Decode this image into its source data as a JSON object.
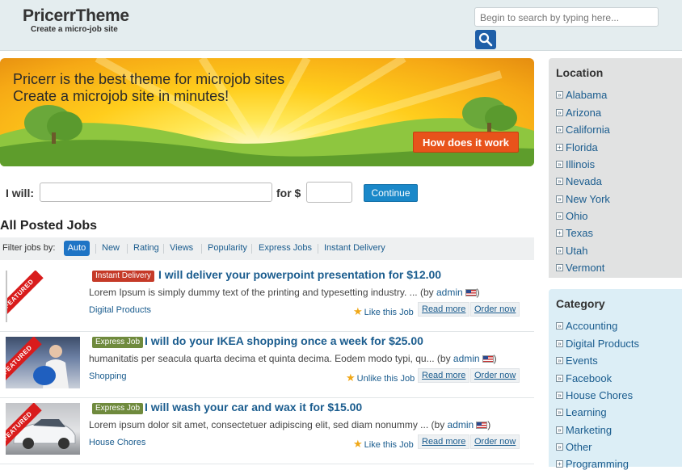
{
  "header": {
    "logo": "PricerrTheme",
    "tagline": "Create a micro-job site",
    "search_placeholder": "Begin to search by typing here..."
  },
  "banner": {
    "line1": "Pricerr is the best theme for microjob sites",
    "line2": "Create a microjob site in minutes!",
    "button": "How does it work"
  },
  "post_form": {
    "i_will_label": "I will:",
    "for_label": "for $",
    "continue_label": "Continue"
  },
  "jobs_section": {
    "title": "All Posted Jobs",
    "filter_label": "Filter jobs by:",
    "filters": [
      "Auto",
      "New",
      "Rating",
      "Views",
      "Popularity",
      "Express Jobs",
      "Instant Delivery"
    ]
  },
  "jobs": [
    {
      "featured": "FEATURED",
      "badge": "Instant Delivery",
      "title": "I will deliver your powerpoint presentation for $12.00",
      "desc": "Lorem Ipsum is simply dummy text of the printing and typesetting industry. ... (by ",
      "author": "admin",
      "desc_end": ")",
      "category": "Digital Products",
      "like": "Like this Job",
      "read_more": "Read more",
      "order_now": "Order now"
    },
    {
      "featured": "FEATURED",
      "badge": "Express Job",
      "title": "I will do your IKEA shopping once a week for $25.00",
      "desc": "humanitatis per seacula quarta decima et quinta decima. Eodem modo typi, qu... (by ",
      "author": "admin",
      "desc_end": ")",
      "category": "Shopping",
      "like": "Unlike this Job",
      "read_more": "Read more",
      "order_now": "Order now"
    },
    {
      "featured": "FEATURED",
      "badge": "Express Job",
      "title": "I will wash your car and wax it for $15.00",
      "desc": "Lorem ipsum dolor sit amet, consectetuer adipiscing elit, sed diam nonummy ... (by ",
      "author": "admin",
      "desc_end": ")",
      "category": "House Chores",
      "like": "Like this Job",
      "read_more": "Read more",
      "order_now": "Order now"
    }
  ],
  "sidebar": {
    "location_title": "Location",
    "locations": [
      "Alabama",
      "Arizona",
      "California",
      "Florida",
      "Illinois",
      "Nevada",
      "New York",
      "Ohio",
      "Texas",
      "Utah",
      "Vermont"
    ],
    "category_title": "Category",
    "categories": [
      "Accounting",
      "Digital Products",
      "Events",
      "Facebook",
      "House Chores",
      "Learning",
      "Marketing",
      "Other",
      "Programming"
    ]
  },
  "colors": {
    "brand_blue": "#1a5c8e",
    "orange_button": "#e8531b",
    "instant_badge": "#c53a28",
    "express_badge": "#6f8a3d"
  }
}
